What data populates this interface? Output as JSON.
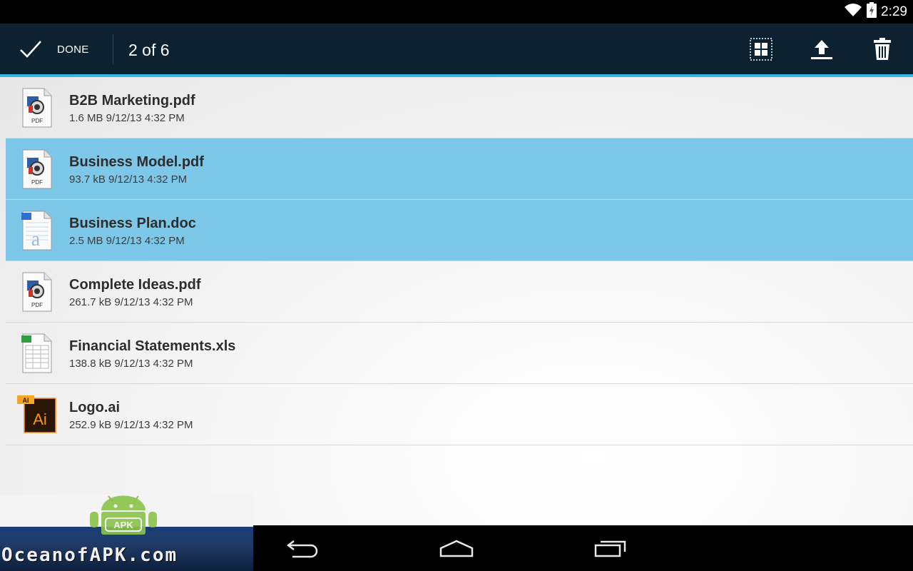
{
  "status_bar": {
    "time": "2:29",
    "icons": [
      "wifi-icon",
      "battery-charging-icon"
    ]
  },
  "action_bar": {
    "done_label": "DONE",
    "selection_count": "2 of 6",
    "actions": [
      "select-all-icon",
      "upload-icon",
      "trash-icon"
    ],
    "accent_color": "#33b5e5",
    "background_color": "#0d2230"
  },
  "files": [
    {
      "name": "B2B Marketing.pdf",
      "meta": "1.6 MB 9/12/13 4:32 PM",
      "type": "pdf",
      "selected": false
    },
    {
      "name": "Business Model.pdf",
      "meta": "93.7 kB 9/12/13 4:32 PM",
      "type": "pdf",
      "selected": true
    },
    {
      "name": "Business Plan.doc",
      "meta": "2.5 MB 9/12/13 4:32 PM",
      "type": "doc",
      "selected": true
    },
    {
      "name": "Complete Ideas.pdf",
      "meta": "261.7 kB 9/12/13 4:32 PM",
      "type": "pdf",
      "selected": false
    },
    {
      "name": "Financial Statements.xls",
      "meta": "138.8 kB 9/12/13 4:32 PM",
      "type": "xls",
      "selected": false
    },
    {
      "name": "Logo.ai",
      "meta": "252.9 kB 9/12/13 4:32 PM",
      "type": "ai",
      "selected": false
    }
  ],
  "icon_labels": {
    "pdf": "PDF",
    "ai_tab": "AI",
    "ai_main": "Ai"
  },
  "selection_color": "#7dc7e9",
  "nav_bar": {
    "buttons": [
      "back-icon",
      "home-icon",
      "recent-apps-icon"
    ]
  },
  "watermark": {
    "text": "OceanofAPK.com",
    "badge": "APK"
  }
}
